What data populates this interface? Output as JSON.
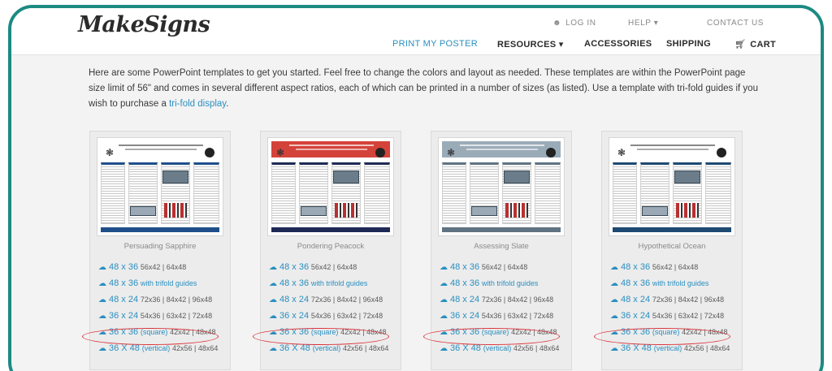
{
  "brand": {
    "logo_text": "MakeSigns"
  },
  "utility_nav": {
    "login": "LOG IN",
    "help": "HELP ▾",
    "contact": "CONTACT US"
  },
  "main_nav": {
    "print_poster": "PRINT MY POSTER",
    "resources": "RESOURCES ▾",
    "accessories": "ACCESSORIES",
    "shipping": "SHIPPING",
    "cart": "CART"
  },
  "intro": {
    "text": "Here are some PowerPoint templates to get you started. Feel free to change the colors and layout as needed. These templates are within the PowerPoint page size limit of 56\" and comes in several different aspect ratios, each of which can be printed in a number of sizes (as listed). Use a template with tri-fold guides if you wish to purchase a ",
    "link": "tri-fold display",
    "end": "."
  },
  "colors": {
    "accent": "#2a8fc0",
    "frame": "#1c8a82",
    "highlight": "#d9323a"
  },
  "templates": [
    {
      "name": "Persuading Sapphire",
      "header_color": "#ffffff",
      "accent": "#1f4f8a",
      "sizes": [
        {
          "main": "48 x 36",
          "extra": "",
          "rest": "56x42 | 64x48"
        },
        {
          "main": "48 x 36",
          "extra": "with trifold guides",
          "rest": ""
        },
        {
          "main": "48 x 24",
          "extra": "",
          "rest": "72x36 | 84x42 | 96x48"
        },
        {
          "main": "36 x 24",
          "extra": "",
          "rest": "54x36 | 63x42 | 72x48"
        },
        {
          "main": "36 x 36",
          "extra": "(square)",
          "rest": "42x42 | 48x48"
        },
        {
          "main": "36 X 48",
          "extra": "(vertical)",
          "rest": "42x56 | 48x64"
        }
      ]
    },
    {
      "name": "Pondering Peacock",
      "header_color": "#d4433a",
      "accent": "#1e2a55",
      "sizes": [
        {
          "main": "48 x 36",
          "extra": "",
          "rest": "56x42 | 64x48"
        },
        {
          "main": "48 x 36",
          "extra": "with trifold guides",
          "rest": ""
        },
        {
          "main": "48 x 24",
          "extra": "",
          "rest": "72x36 | 84x42 | 96x48"
        },
        {
          "main": "36 x 24",
          "extra": "",
          "rest": "54x36 | 63x42 | 72x48"
        },
        {
          "main": "36 x 36",
          "extra": "(square)",
          "rest": "42x42 | 48x48"
        },
        {
          "main": "36 X 48",
          "extra": "(vertical)",
          "rest": "42x56 | 48x64"
        }
      ]
    },
    {
      "name": "Assessing Slate",
      "header_color": "#9aabb8",
      "accent": "#5f7382",
      "sizes": [
        {
          "main": "48 x 36",
          "extra": "",
          "rest": "56x42 | 64x48"
        },
        {
          "main": "48 x 36",
          "extra": "with trifold guides",
          "rest": ""
        },
        {
          "main": "48 x 24",
          "extra": "",
          "rest": "72x36 | 84x42 | 96x48"
        },
        {
          "main": "36 x 24",
          "extra": "",
          "rest": "54x36 | 63x42 | 72x48"
        },
        {
          "main": "36 x 36",
          "extra": "(square)",
          "rest": "42x42 | 48x48"
        },
        {
          "main": "36 X 48",
          "extra": "(vertical)",
          "rest": "42x56 | 48x64"
        }
      ]
    },
    {
      "name": "Hypothetical Ocean",
      "header_color": "#ffffff",
      "accent": "#1e4a74",
      "sizes": [
        {
          "main": "48 x 36",
          "extra": "",
          "rest": "56x42 | 64x48"
        },
        {
          "main": "48 x 36",
          "extra": "with trifold guides",
          "rest": ""
        },
        {
          "main": "48 x 24",
          "extra": "",
          "rest": "72x36 | 84x42 | 96x48"
        },
        {
          "main": "36 x 24",
          "extra": "",
          "rest": "54x36 | 63x42 | 72x48"
        },
        {
          "main": "36 x 36",
          "extra": "(square)",
          "rest": "42x42 | 48x48"
        },
        {
          "main": "36 X 48",
          "extra": "(vertical)",
          "rest": "42x56 | 48x64"
        }
      ]
    }
  ]
}
